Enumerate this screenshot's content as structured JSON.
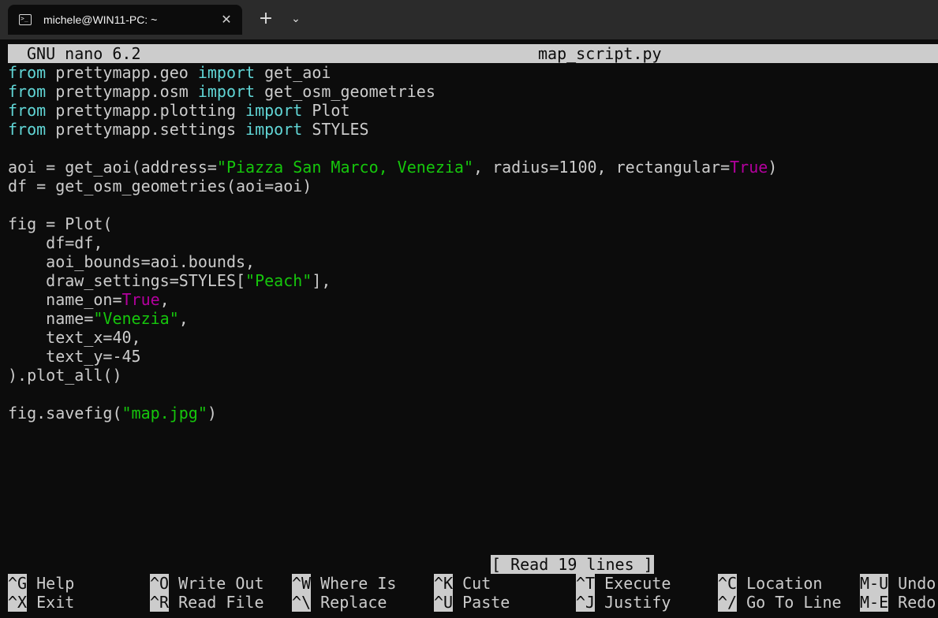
{
  "window": {
    "tab_title": "michele@WIN11-PC: ~",
    "tab_icon": "terminal-icon",
    "close_glyph": "✕",
    "new_tab_glyph": "+",
    "dropdown_glyph": "⌄"
  },
  "nano": {
    "version": "GNU nano 6.2",
    "filename": "map_script.py",
    "status": "[ Read 19 lines ]"
  },
  "code": {
    "l1": {
      "a": "from",
      "b": " prettymapp.geo ",
      "c": "import",
      "d": " get_aoi"
    },
    "l2": {
      "a": "from",
      "b": " prettymapp.osm ",
      "c": "import",
      "d": " get_osm_geometries"
    },
    "l3": {
      "a": "from",
      "b": " prettymapp.plotting ",
      "c": "import",
      "d": " Plot"
    },
    "l4": {
      "a": "from",
      "b": " prettymapp.settings ",
      "c": "import",
      "d": " STYLES"
    },
    "l6": {
      "a": "aoi = get_aoi(address=",
      "b": "\"Piazza San Marco, Venezia\"",
      "c": ", radius=1100, rectangular=",
      "d": "True",
      "e": ")"
    },
    "l7": "df = get_osm_geometries(aoi=aoi)",
    "l9": "fig = Plot(",
    "l10": "    df=df,",
    "l11": "    aoi_bounds=aoi.bounds,",
    "l12": {
      "a": "    draw_settings=STYLES[",
      "b": "\"Peach\"",
      "c": "],"
    },
    "l13": {
      "a": "    name_on=",
      "b": "True",
      "c": ","
    },
    "l14": {
      "a": "    name=",
      "b": "\"Venezia\"",
      "c": ","
    },
    "l15": "    text_x=40,",
    "l16": "    text_y=-45",
    "l17": ").plot_all()",
    "l19": {
      "a": "fig.savefig(",
      "b": "\"map.jpg\"",
      "c": ")"
    }
  },
  "shortcuts": [
    {
      "key": "^G",
      "label": " Help"
    },
    {
      "key": "^X",
      "label": " Exit"
    },
    {
      "key": "^O",
      "label": " Write Out"
    },
    {
      "key": "^R",
      "label": " Read File"
    },
    {
      "key": "^W",
      "label": " Where Is"
    },
    {
      "key": "^\\",
      "label": " Replace"
    },
    {
      "key": "^K",
      "label": " Cut"
    },
    {
      "key": "^U",
      "label": " Paste"
    },
    {
      "key": "^T",
      "label": " Execute"
    },
    {
      "key": "^J",
      "label": " Justify"
    },
    {
      "key": "^C",
      "label": " Location"
    },
    {
      "key": "^/",
      "label": " Go To Line"
    },
    {
      "key": "M-U",
      "label": " Undo"
    },
    {
      "key": "M-E",
      "label": " Redo"
    }
  ]
}
